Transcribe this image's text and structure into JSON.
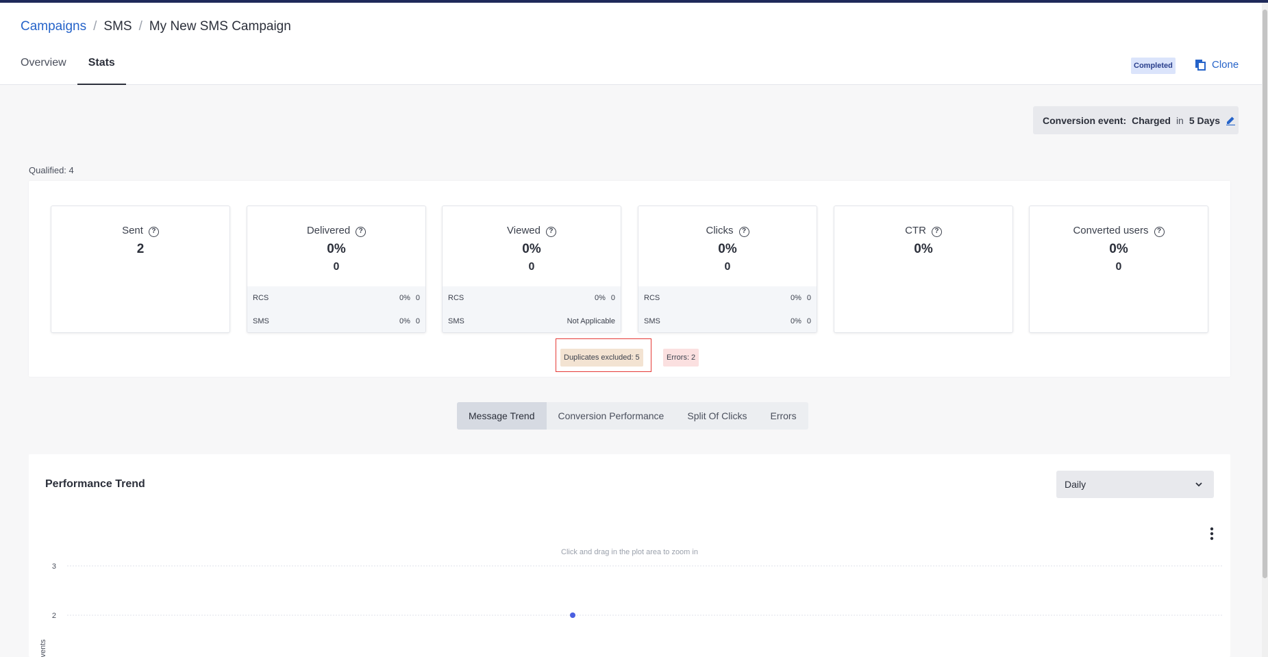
{
  "breadcrumb": {
    "root": "Campaigns",
    "sep": "/",
    "channel": "SMS",
    "current": "My New SMS Campaign"
  },
  "tabs": [
    {
      "label": "Overview"
    },
    {
      "label": "Stats"
    }
  ],
  "status": "Completed",
  "clone_label": "Clone",
  "conversion": {
    "label": "Conversion event:",
    "event": "Charged",
    "in": "in",
    "window": "5 Days"
  },
  "qualified": "Qualified: 4",
  "metrics": [
    {
      "title": "Sent",
      "main": "2",
      "sub": ""
    },
    {
      "title": "Delivered",
      "main": "0%",
      "sub": "0",
      "rows": [
        {
          "label": "RCS",
          "pct": "0%",
          "count": "0"
        },
        {
          "label": "SMS",
          "pct": "0%",
          "count": "0"
        }
      ]
    },
    {
      "title": "Viewed",
      "main": "0%",
      "sub": "0",
      "rows": [
        {
          "label": "RCS",
          "pct": "0%",
          "count": "0"
        },
        {
          "label": "SMS",
          "pct": "Not Applicable",
          "count": ""
        }
      ]
    },
    {
      "title": "Clicks",
      "main": "0%",
      "sub": "0",
      "rows": [
        {
          "label": "RCS",
          "pct": "0%",
          "count": "0"
        },
        {
          "label": "SMS",
          "pct": "0%",
          "count": "0"
        }
      ]
    },
    {
      "title": "CTR",
      "main": "0%",
      "sub": ""
    },
    {
      "title": "Converted users",
      "main": "0%",
      "sub": "0"
    }
  ],
  "badges": {
    "duplicates": "Duplicates excluded: 5",
    "errors": "Errors: 2"
  },
  "view_tabs": [
    "Message Trend",
    "Conversion Performance",
    "Split Of Clicks",
    "Errors"
  ],
  "trend": {
    "title": "Performance Trend",
    "granularity": "Daily",
    "zoom_hint": "Click and drag in the plot area to zoom in"
  },
  "colors": {
    "accent": "#2563c9",
    "point": "#4a5fe0",
    "highlight": "#e53935"
  },
  "chart_data": {
    "type": "scatter",
    "ylabel": "Events",
    "y_ticks": [
      2,
      3
    ],
    "series": [
      {
        "values": [
          2
        ]
      }
    ]
  }
}
